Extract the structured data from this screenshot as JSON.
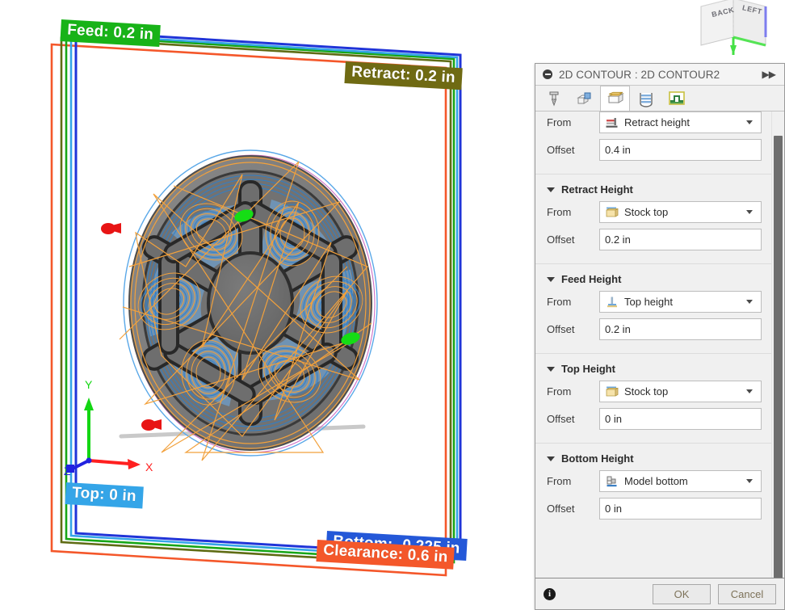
{
  "viewport": {
    "labels": [
      {
        "id": "feed",
        "text": "Feed: 0.2 in",
        "color": "#18b318"
      },
      {
        "id": "retract",
        "text": "Retract: 0.2 in",
        "color": "#6f6a13"
      },
      {
        "id": "top",
        "text": "Top: 0 in",
        "color": "#34a5e8"
      },
      {
        "id": "bottom",
        "text": "Bottom: -0.225 in",
        "color": "#2458d8"
      },
      {
        "id": "clearance",
        "text": "Clearance: 0.6 in",
        "color": "#f4572a"
      }
    ],
    "axis": {
      "x": "X",
      "y": "Y",
      "z": "Z"
    },
    "viewcube": {
      "back": "BACK",
      "left": "LEFT"
    }
  },
  "panel": {
    "title": "2D CONTOUR : 2D CONTOUR2",
    "collapse_icon": "collapse-icon",
    "expand_label": "▶▶",
    "tabs": [
      {
        "name": "tool",
        "icon": "endmill-tool-icon",
        "selected": false
      },
      {
        "name": "geometry",
        "icon": "geometry-icon",
        "selected": false
      },
      {
        "name": "heights",
        "icon": "heights-icon",
        "selected": true
      },
      {
        "name": "passes",
        "icon": "passes-icon",
        "selected": false
      },
      {
        "name": "linking",
        "icon": "linking-icon",
        "selected": false
      }
    ],
    "groups": [
      {
        "id": "clearance-height",
        "title": "",
        "partial": true,
        "from_label": "From",
        "from_value": "Retract height",
        "from_icon": "retract-height-icon",
        "offset_label": "Offset",
        "offset_value": "0.4 in"
      },
      {
        "id": "retract-height",
        "title": "Retract Height",
        "partial": false,
        "from_label": "From",
        "from_value": "Stock top",
        "from_icon": "stock-top-icon",
        "offset_label": "Offset",
        "offset_value": "0.2 in"
      },
      {
        "id": "feed-height",
        "title": "Feed Height",
        "partial": false,
        "from_label": "From",
        "from_value": "Top height",
        "from_icon": "top-height-icon",
        "offset_label": "Offset",
        "offset_value": "0.2 in"
      },
      {
        "id": "top-height",
        "title": "Top Height",
        "partial": false,
        "from_label": "From",
        "from_value": "Stock top",
        "from_icon": "stock-top-icon",
        "offset_label": "Offset",
        "offset_value": "0 in"
      },
      {
        "id": "bottom-height",
        "title": "Bottom Height",
        "partial": false,
        "from_label": "From",
        "from_value": "Model bottom",
        "from_icon": "model-bottom-icon",
        "offset_label": "Offset",
        "offset_value": "0 in"
      }
    ],
    "footer": {
      "info_icon": "info-icon",
      "info_glyph": "i",
      "ok_label": "OK",
      "cancel_label": "Cancel"
    }
  }
}
